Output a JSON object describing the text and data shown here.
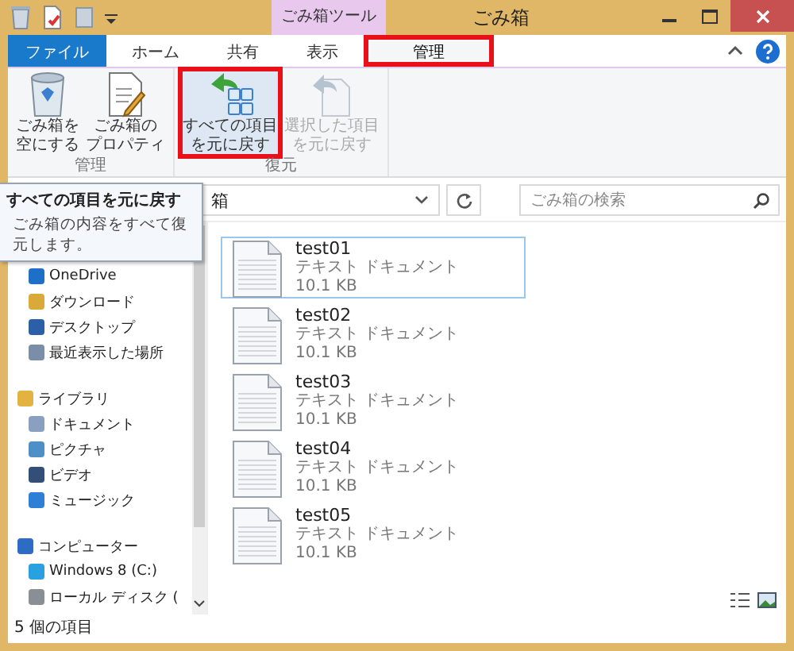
{
  "window": {
    "title": "ごみ箱",
    "context_tab": "ごみ箱ツール"
  },
  "tabs": [
    {
      "label": "ファイル",
      "kind": "file",
      "selected": false,
      "highlighted": false
    },
    {
      "label": "ホーム",
      "kind": "plain",
      "selected": false,
      "highlighted": false
    },
    {
      "label": "共有",
      "kind": "plain",
      "selected": false,
      "highlighted": false
    },
    {
      "label": "表示",
      "kind": "plain",
      "selected": false,
      "highlighted": false
    },
    {
      "label": "管理",
      "kind": "context",
      "selected": true,
      "highlighted": true
    }
  ],
  "ribbon_groups": [
    {
      "label": "管理",
      "buttons": [
        {
          "lines": [
            "ごみ箱を",
            "空にする"
          ],
          "disabled": false,
          "highlighted": false
        },
        {
          "lines": [
            "ごみ箱の",
            "プロパティ"
          ],
          "disabled": false,
          "highlighted": false
        }
      ]
    },
    {
      "label": "復元",
      "buttons": [
        {
          "lines": [
            "すべての項目",
            "を元に戻す"
          ],
          "disabled": false,
          "highlighted": true
        },
        {
          "lines": [
            "選択した項目",
            "を元に戻す"
          ],
          "disabled": true,
          "highlighted": false
        }
      ]
    }
  ],
  "tooltip": {
    "title": "すべての項目を元に戻す",
    "text": "ごみ箱の内容をすべて復元します。"
  },
  "address": {
    "value": "箱"
  },
  "search": {
    "placeholder": "ごみ箱の検索"
  },
  "nav": [
    {
      "items": [
        {
          "label": "OneDrive"
        },
        {
          "label": "ダウンロード"
        },
        {
          "label": "デスクトップ"
        },
        {
          "label": "最近表示した場所"
        }
      ]
    },
    {
      "label": "ライブラリ",
      "children": [
        {
          "label": "ドキュメント"
        },
        {
          "label": "ピクチャ"
        },
        {
          "label": "ビデオ"
        },
        {
          "label": "ミュージック"
        }
      ]
    },
    {
      "label": "コンピューター",
      "children": [
        {
          "label": "Windows 8 (C:)"
        },
        {
          "label": "ローカル ディスク ("
        }
      ]
    }
  ],
  "files": [
    {
      "name": "test01",
      "type": "テキスト ドキュメント",
      "size": "10.1 KB",
      "selected": true
    },
    {
      "name": "test02",
      "type": "テキスト ドキュメント",
      "size": "10.1 KB",
      "selected": false
    },
    {
      "name": "test03",
      "type": "テキスト ドキュメント",
      "size": "10.1 KB",
      "selected": false
    },
    {
      "name": "test04",
      "type": "テキスト ドキュメント",
      "size": "10.1 KB",
      "selected": false
    },
    {
      "name": "test05",
      "type": "テキスト ドキュメント",
      "size": "10.1 KB",
      "selected": false
    }
  ],
  "status_bar": "5 個の項目"
}
